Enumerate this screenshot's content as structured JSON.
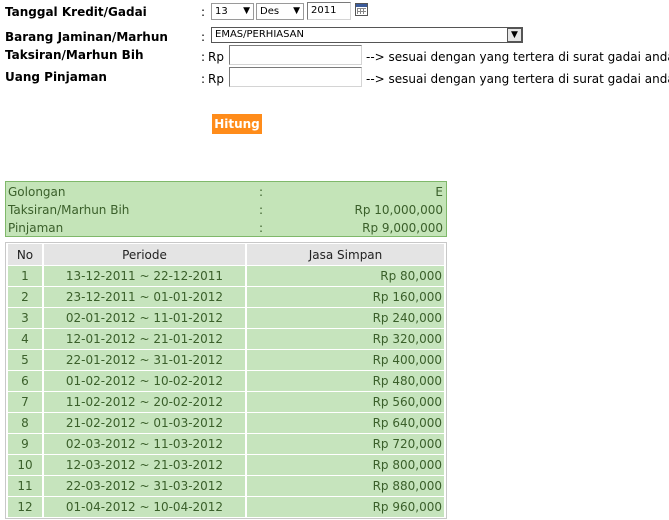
{
  "form": {
    "tanggal_label": "Tanggal Kredit/Gadai",
    "tanggal_day": "13",
    "tanggal_month": "Des",
    "tanggal_year": "2011",
    "barang_label": "Barang Jaminan/Marhun",
    "barang_value": "EMAS/PERHIASAN",
    "taksiran_label": "Taksiran/Marhun Bih",
    "uang_label": "Uang Pinjaman",
    "colon": ":",
    "rp": "Rp",
    "note": "--> sesuai dengan yang tertera di surat gadai anda",
    "hitung_label": "Hitung"
  },
  "summary": [
    {
      "key": "Golongan",
      "colon": ":",
      "value": "E"
    },
    {
      "key": "Taksiran/Marhun Bih",
      "colon": ":",
      "value": "Rp 10,000,000"
    },
    {
      "key": "Pinjaman",
      "colon": ":",
      "value": "Rp 9,000,000"
    }
  ],
  "table": {
    "headers": [
      "No",
      "Periode",
      "Jasa Simpan"
    ],
    "rows": [
      {
        "no": "1",
        "periode": "13-12-2011 ~ 22-12-2011",
        "jasa": "Rp 80,000"
      },
      {
        "no": "2",
        "periode": "23-12-2011 ~ 01-01-2012",
        "jasa": "Rp 160,000"
      },
      {
        "no": "3",
        "periode": "02-01-2012 ~ 11-01-2012",
        "jasa": "Rp 240,000"
      },
      {
        "no": "4",
        "periode": "12-01-2012 ~ 21-01-2012",
        "jasa": "Rp 320,000"
      },
      {
        "no": "5",
        "periode": "22-01-2012 ~ 31-01-2012",
        "jasa": "Rp 400,000"
      },
      {
        "no": "6",
        "periode": "01-02-2012 ~ 10-02-2012",
        "jasa": "Rp 480,000"
      },
      {
        "no": "7",
        "periode": "11-02-2012 ~ 20-02-2012",
        "jasa": "Rp 560,000"
      },
      {
        "no": "8",
        "periode": "21-02-2012 ~ 01-03-2012",
        "jasa": "Rp 640,000"
      },
      {
        "no": "9",
        "periode": "02-03-2012 ~ 11-03-2012",
        "jasa": "Rp 720,000"
      },
      {
        "no": "10",
        "periode": "12-03-2012 ~ 21-03-2012",
        "jasa": "Rp 800,000"
      },
      {
        "no": "11",
        "periode": "22-03-2012 ~ 31-03-2012",
        "jasa": "Rp 880,000"
      },
      {
        "no": "12",
        "periode": "01-04-2012 ~ 10-04-2012",
        "jasa": "Rp 960,000"
      }
    ]
  }
}
